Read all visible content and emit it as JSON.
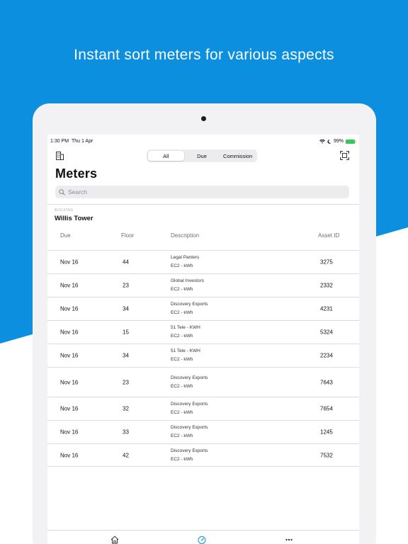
{
  "headline": "Instant sort meters for various aspects",
  "status_bar": {
    "time": "1:30 PM",
    "date": "Thu 1 Apr",
    "battery": "99%"
  },
  "header": {
    "segments": [
      "All",
      "Due",
      "Commission"
    ],
    "selected_segment": "All"
  },
  "page_title": "Meters",
  "search": {
    "placeholder": "Search"
  },
  "building": {
    "label": "BUILDING",
    "name": "Willis Tower"
  },
  "table": {
    "columns": [
      "Due",
      "Floor",
      "Description",
      "Asset ID"
    ],
    "rows": [
      {
        "due": "Nov 16",
        "floor": "44",
        "desc_title": "Legal Panters",
        "desc_sub": "EC2 - kWh",
        "asset_id": "3275"
      },
      {
        "due": "Nov 16",
        "floor": "23",
        "desc_title": "Global Investors",
        "desc_sub": "EC2 - kWh",
        "asset_id": "2332"
      },
      {
        "due": "Nov 16",
        "floor": "34",
        "desc_title": "Discovery Exports",
        "desc_sub": "EC2 - kWh",
        "asset_id": "4231"
      },
      {
        "due": "Nov 16",
        "floor": "15",
        "desc_title": "51 Tele - KWH",
        "desc_sub": "EC2 - kWh",
        "asset_id": "5324"
      },
      {
        "due": "Nov 16",
        "floor": "34",
        "desc_title": "51 Tele - KWH",
        "desc_sub": "EC2 - kWh",
        "asset_id": "2234"
      },
      {
        "due": "Nov 16",
        "floor": "23",
        "desc_title": "Discovery Exports",
        "desc_sub": "EC2 - kWh",
        "asset_id": "7643"
      },
      {
        "due": "Nov 16",
        "floor": "32",
        "desc_title": "Discovery Exports",
        "desc_sub": "EC2 - kWh",
        "asset_id": "7654"
      },
      {
        "due": "Nov 16",
        "floor": "33",
        "desc_title": "Discovery Exports",
        "desc_sub": "EC2 - kWh",
        "asset_id": "1245"
      },
      {
        "due": "Nov 16",
        "floor": "42",
        "desc_title": "Discovery Exports",
        "desc_sub": "EC2 - kWh",
        "asset_id": "7532"
      }
    ]
  },
  "tab_bar": {
    "icons": [
      "home-icon",
      "gauge-icon",
      "more-icon"
    ]
  },
  "colors": {
    "brand_blue": "#0b8fde",
    "battery_green": "#34c759"
  }
}
